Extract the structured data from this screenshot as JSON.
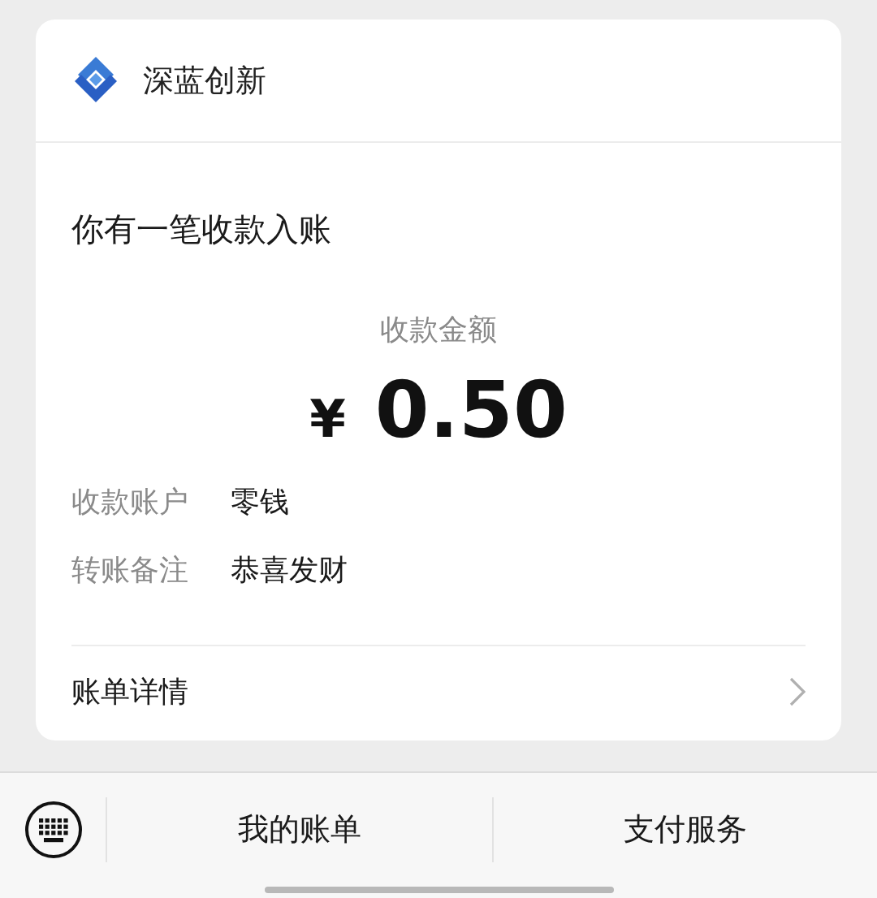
{
  "header": {
    "brand": "深蓝创新"
  },
  "message": {
    "title": "你有一笔收款入账",
    "amount_label": "收款金额",
    "currency": "¥",
    "amount": "0.50",
    "fields": [
      {
        "label": "收款账户",
        "value": "零钱"
      },
      {
        "label": "转账备注",
        "value": "恭喜发财"
      }
    ],
    "details_link": "账单详情"
  },
  "bottom_bar": {
    "items": [
      "我的账单",
      "支付服务"
    ]
  }
}
